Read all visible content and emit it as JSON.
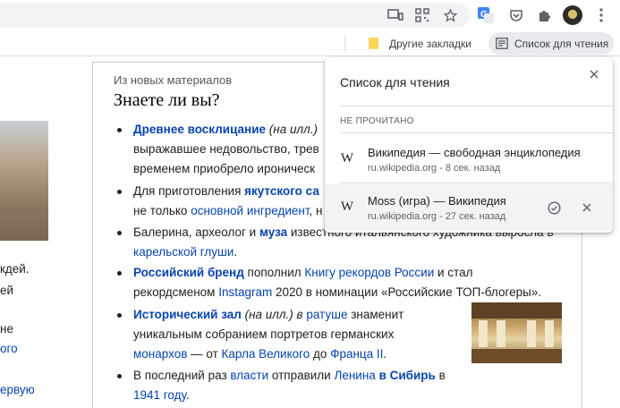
{
  "browser": {
    "bookmarks_bar": {
      "other_bookmarks_label": "Другие закладки",
      "reading_list_label": "Список для чтения"
    },
    "toolbar_icons": [
      "cast-icon",
      "qr-code-icon",
      "star-icon",
      "translate-icon",
      "pocket-icon",
      "extensions-icon",
      "avatar-icon"
    ]
  },
  "reading_list": {
    "title": "Список для чтения",
    "section": "НЕ ПРОЧИТАНО",
    "items": [
      {
        "title": "Википедия — свободная энциклопедия",
        "source": "ru.wikipedia.org - 8 сек. назад"
      },
      {
        "title": "Moss (игра) — Википедия",
        "source": "ru.wikipedia.org - 27 сек. назад"
      }
    ]
  },
  "article": {
    "kicker": "Из новых материалов",
    "heading": "Знаете ли вы?",
    "left_fragments": [
      "кдей.",
      "ей",
      "не",
      "ого",
      "ервую"
    ],
    "items": [
      {
        "lines": [
          {
            "bold_link": "Древнее восклицание",
            "text": " (на илл.)"
          },
          {
            "text": "выражавшее недовольство, трев"
          },
          {
            "text": "временем приобрело ироническ"
          }
        ]
      },
      {
        "lines": [
          {
            "text": "Для приготовления ",
            "bold_link": "якутского са"
          },
          {
            "text": "не только ",
            "link": "основной ингредиент",
            "tail": ", н"
          }
        ]
      },
      {
        "lines": [
          {
            "text": "Балерина, археолог и ",
            "bold_link": "муза",
            "tail": " известного итальянского художника выросла в"
          },
          {
            "link": "карельской глуши",
            "tail": "."
          }
        ]
      },
      {
        "lines": [
          {
            "bold_link": "Российский бренд",
            "text": " пополнил ",
            "link": "Книгу рекордов России",
            "tail": " и стал"
          },
          {
            "text": "рекордсменом ",
            "link": "Instagram",
            "tail": " 2020 в номинации «Российские ТОП-блогеры»."
          }
        ]
      },
      {
        "lines": [
          {
            "bold_link": "Исторический зал",
            "text": " (на илл.) в ",
            "link": "ратуше",
            "tail": " знаменит"
          },
          {
            "text": "уникальным собранием портретов германских"
          },
          {
            "link": "монархов",
            "text": " — от ",
            "link2": "Карла Великого",
            "mid": " до ",
            "link3": "Франца II",
            "tail": "."
          }
        ]
      },
      {
        "lines": [
          {
            "text": "В последний раз ",
            "link": "власти",
            "mid": " отправили ",
            "link2": "Ленина",
            "bold_link": " в Сибирь",
            "tail": " в"
          },
          {
            "link": "1941 году",
            "tail": "."
          }
        ]
      }
    ]
  }
}
